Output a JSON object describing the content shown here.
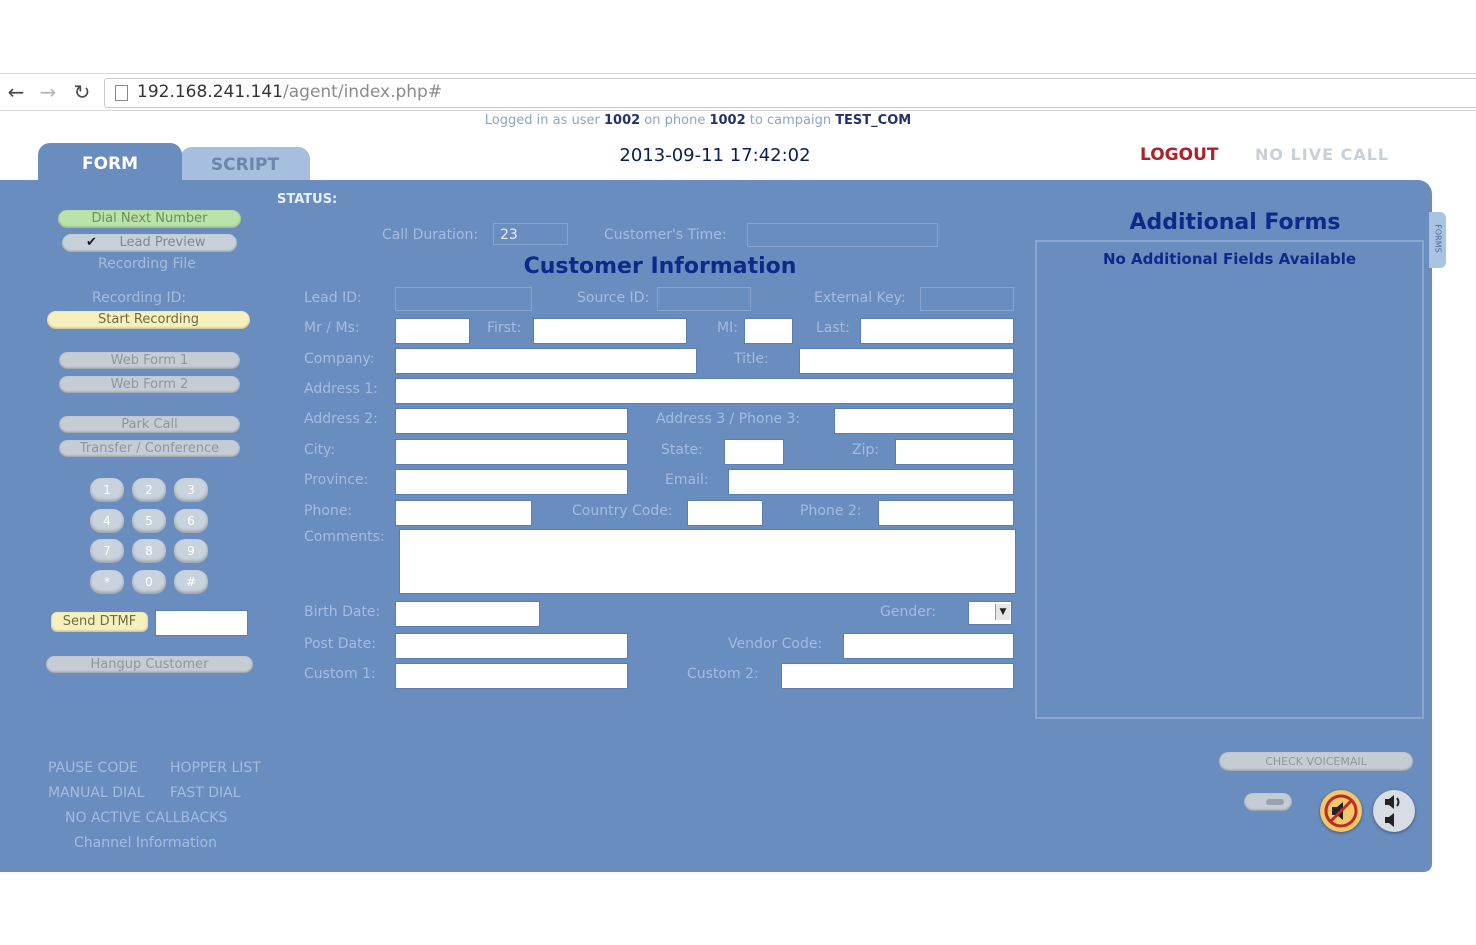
{
  "browser": {
    "url_host": "192.168.241.141",
    "url_path": "/agent/index.php#"
  },
  "login": {
    "prefix": "Logged in as user ",
    "user": "1002",
    "phone_text": " on phone ",
    "phone": "1002",
    "campaign_text": " to campaign ",
    "campaign": "TEST_COM"
  },
  "tabs": {
    "form": "FORM",
    "script": "SCRIPT"
  },
  "header": {
    "datetime": "2013-09-11 17:42:02",
    "logout": "LOGOUT",
    "live_status": "NO LIVE CALL"
  },
  "left": {
    "dial_next": "Dial Next Number",
    "lead_preview": "Lead Preview",
    "lead_preview_checked": "✔",
    "recording_file": "Recording File",
    "recording_id": "Recording ID:",
    "start_recording": "Start Recording",
    "web_form_1": "Web Form 1",
    "web_form_2": "Web Form 2",
    "park_call": "Park Call",
    "transfer": "Transfer / Conference",
    "keypad": [
      "1",
      "2",
      "3",
      "4",
      "5",
      "6",
      "7",
      "8",
      "9",
      "*",
      "0",
      "#"
    ],
    "send_dtmf": "Send DTMF",
    "hangup": "Hangup Customer",
    "pause_code": "PAUSE CODE",
    "hopper_list": "HOPPER LIST",
    "manual_dial": "MANUAL DIAL",
    "fast_dial": "FAST DIAL",
    "no_callbacks": "NO ACTIVE CALLBACKS",
    "channel_info": "Channel Information"
  },
  "status": {
    "label": "STATUS:",
    "call_duration_label": "Call Duration:",
    "call_duration": "23",
    "customer_time_label": "Customer's Time:"
  },
  "customer": {
    "title": "Customer Information",
    "lead_id": "Lead ID:",
    "source_id": "Source ID:",
    "external_key": "External Key:",
    "salutation": "Mr / Ms:",
    "first": "First:",
    "mi": "MI:",
    "last": "Last:",
    "company": "Company:",
    "title_label": "Title:",
    "address1": "Address 1:",
    "address2": "Address 2:",
    "address3": "Address 3 / Phone 3:",
    "city": "City:",
    "state": "State:",
    "zip": "Zip:",
    "province": "Province:",
    "email": "Email:",
    "phone": "Phone:",
    "country_code": "Country Code:",
    "phone2": "Phone 2:",
    "comments": "Comments:",
    "birth_date": "Birth Date:",
    "gender": "Gender:",
    "post_date": "Post Date:",
    "vendor_code": "Vendor Code:",
    "custom1": "Custom 1:",
    "custom2": "Custom 2:"
  },
  "additional": {
    "title": "Additional Forms",
    "empty": "No Additional Fields Available",
    "tab_label": "FORMS"
  },
  "bottom_right": {
    "check_voicemail": "CHECK VOICEMAIL"
  },
  "colors": {
    "panel": "#6a8dbf",
    "label": "#a3bce0",
    "heading": "#0d2a8a",
    "logout": "#b0202a"
  }
}
